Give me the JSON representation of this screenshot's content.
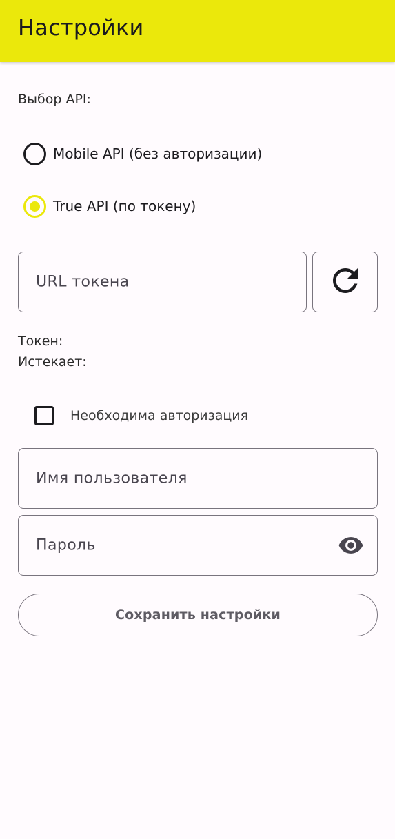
{
  "app_bar": {
    "title": "Настройки",
    "background": "#ebe80b"
  },
  "api_section": {
    "label": "Выбор API:",
    "options": [
      {
        "label": "Mobile API (без авторизации)",
        "selected": false
      },
      {
        "label": "True API (по токену)",
        "selected": true
      }
    ]
  },
  "token_url": {
    "placeholder": "URL токена",
    "refresh_icon": "refresh-icon"
  },
  "token_info": {
    "token_label": "Токен:",
    "expires_label": "Истекает:"
  },
  "auth": {
    "checkbox_label": "Необходима авторизация",
    "checked": false,
    "username_placeholder": "Имя пользователя",
    "password_placeholder": "Пароль",
    "password_toggle_icon": "eye-icon"
  },
  "save_button": {
    "label": "Сохранить настройки"
  },
  "colors": {
    "accent": "#ebe80b",
    "outline": "#79747e",
    "background": "#fffbfe"
  }
}
